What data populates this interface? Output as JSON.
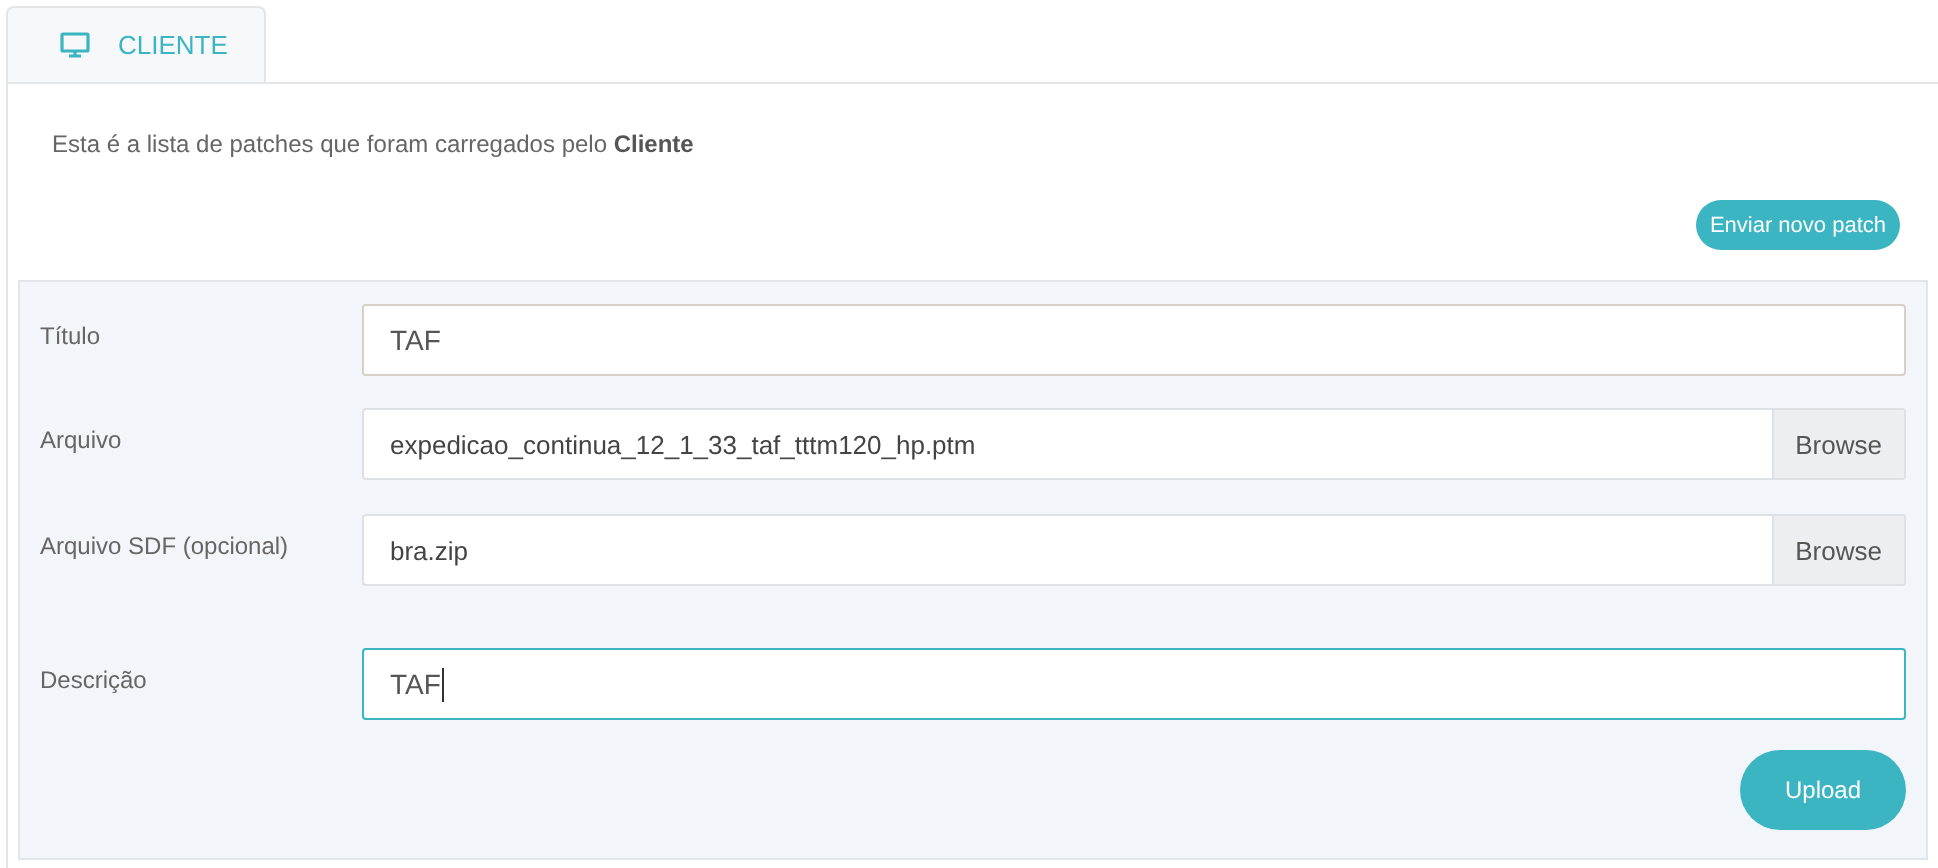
{
  "tabs": [
    {
      "label": "CLIENTE",
      "selected": true
    }
  ],
  "intro": "Esta é a lista de patches que foram carregados pelo **Cliente**",
  "new_patch_button": "Enviar novo patch",
  "form": {
    "fields": [
      {
        "kind": "text",
        "label": "Título",
        "value": "TAF",
        "focused": false
      },
      {
        "kind": "file",
        "label": "Arquivo",
        "value": "expedicao_continua_12_1_33_taf_tttm120_hp.ptm",
        "browse": "Browse",
        "focused": false
      },
      {
        "kind": "file",
        "label": "Arquivo SDF (opcional)",
        "value": "bra.zip",
        "browse": "Browse",
        "focused": false
      },
      {
        "kind": "text",
        "label": "Descrição",
        "value": "TAF",
        "focused": true
      }
    ],
    "submit": "Upload"
  }
}
